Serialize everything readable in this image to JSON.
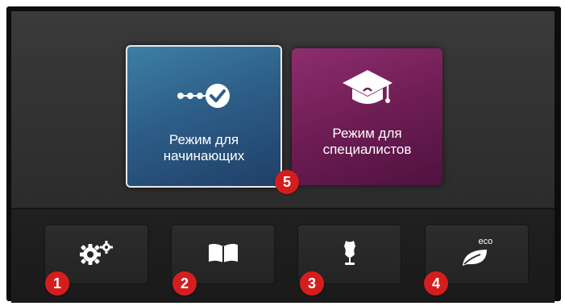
{
  "modes": {
    "beginner": {
      "label_line1": "Режим для",
      "label_line2": "начинающих",
      "icon": "steps-check-icon",
      "color": "#2d5e88",
      "selected": true
    },
    "expert": {
      "label_line1": "Режим для",
      "label_line2": "специалистов",
      "icon": "graduation-cap-icon",
      "color": "#6e1d54"
    }
  },
  "function_buttons": [
    {
      "icon": "settings-gears-icon"
    },
    {
      "icon": "book-icon"
    },
    {
      "icon": "dress-form-icon"
    },
    {
      "icon": "eco-leaf-icon",
      "text": "eco"
    }
  ],
  "callouts": [
    "1",
    "2",
    "3",
    "4",
    "5"
  ],
  "colors": {
    "callout": "#d41e1e"
  }
}
